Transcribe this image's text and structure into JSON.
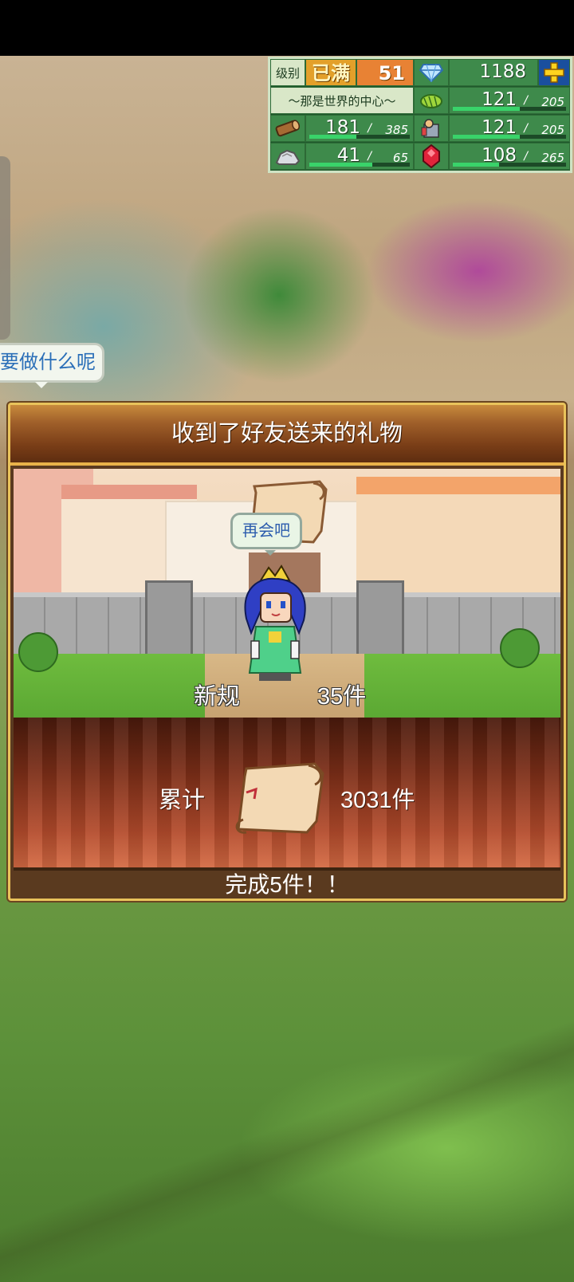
{
  "resources": {
    "level_label": "级别",
    "rank": "已满",
    "level": "51",
    "gems": "1188",
    "town_title": "～那是世界的中心～",
    "food": {
      "current": "121",
      "max": "205",
      "fill": 0.59
    },
    "wood": {
      "current": "181",
      "max": "385",
      "fill": 0.47
    },
    "staff": {
      "current": "121",
      "max": "205",
      "fill": 0.59
    },
    "stone": {
      "current": "41",
      "max": "65",
      "fill": 0.63
    },
    "ruby": {
      "current": "108",
      "max": "265",
      "fill": 0.41
    },
    "slash": "/"
  },
  "side_bubble": "要做什么呢",
  "dialog": {
    "title": "收到了好友送来的礼物",
    "speech": "再会吧",
    "new_label": "新规",
    "new_count": "35件",
    "total_label": "累计",
    "total_count": "3031件",
    "footer": "完成5件！！"
  },
  "colors": {
    "panel_bg": "#1f5a2c",
    "bar_fill": "#39d36a",
    "dialog_border": "#e9c35b",
    "speech_text": "#2b5cad"
  },
  "icons": [
    "diamond-icon",
    "plus-icon",
    "crop-icon",
    "log-icon",
    "staff-icon",
    "stone-icon",
    "ruby-icon",
    "scroll-icon",
    "character-sprite"
  ]
}
